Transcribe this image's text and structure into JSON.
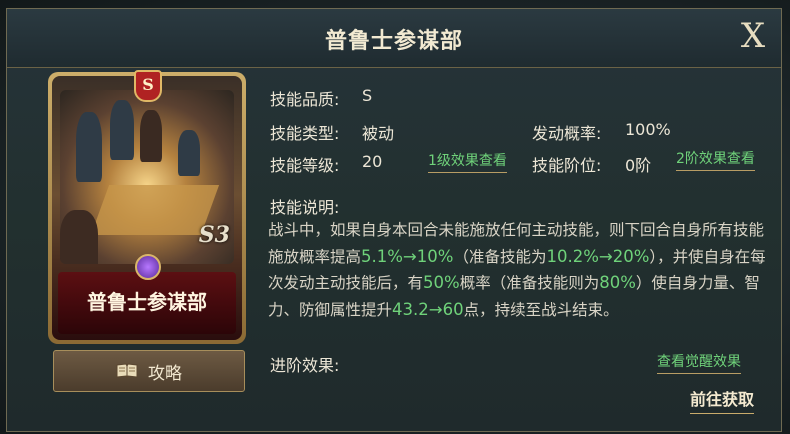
{
  "title": "普鲁士参谋部",
  "close_label": "X",
  "card": {
    "rank_badge": "S",
    "level_mark": "S3",
    "name": "普鲁士参谋部"
  },
  "guide_button": {
    "label": "攻略",
    "icon": "book-icon"
  },
  "info": {
    "quality_label": "技能品质:",
    "quality_value": "S",
    "type_label": "技能类型:",
    "type_value": "被动",
    "chance_label": "发动概率:",
    "chance_value": "100%",
    "level_label": "技能等级:",
    "level_value": "20",
    "level_link": "1级效果查看",
    "tier_label": "技能阶位:",
    "tier_value": "0阶",
    "tier_link": "2阶效果查看"
  },
  "description": {
    "label": "技能说明:",
    "parts": [
      {
        "t": "战斗中，如果自身本回合未能施放任何主动技能，则下回合自身所有技能施放概率提高",
        "hl": false
      },
      {
        "t": "5.1%→10%",
        "hl": true
      },
      {
        "t": "（准备技能为",
        "hl": false
      },
      {
        "t": "10.2%→20%",
        "hl": true
      },
      {
        "t": "），并使自身在每次发动主动技能后，有",
        "hl": false
      },
      {
        "t": "50%",
        "hl": true
      },
      {
        "t": "概率（准备技能则为",
        "hl": false
      },
      {
        "t": "80%",
        "hl": true
      },
      {
        "t": "）使自身力量、智力、防御属性提升",
        "hl": false
      },
      {
        "t": "43.2→60",
        "hl": true
      },
      {
        "t": "点，持续至战斗结束。",
        "hl": false
      }
    ]
  },
  "advance": {
    "label": "进阶效果:",
    "link": "查看觉醒效果"
  },
  "goto_label": "前往获取",
  "colors": {
    "highlight": "#6fd27a",
    "text": "#ece6d6",
    "gold": "#c9ab6b"
  }
}
